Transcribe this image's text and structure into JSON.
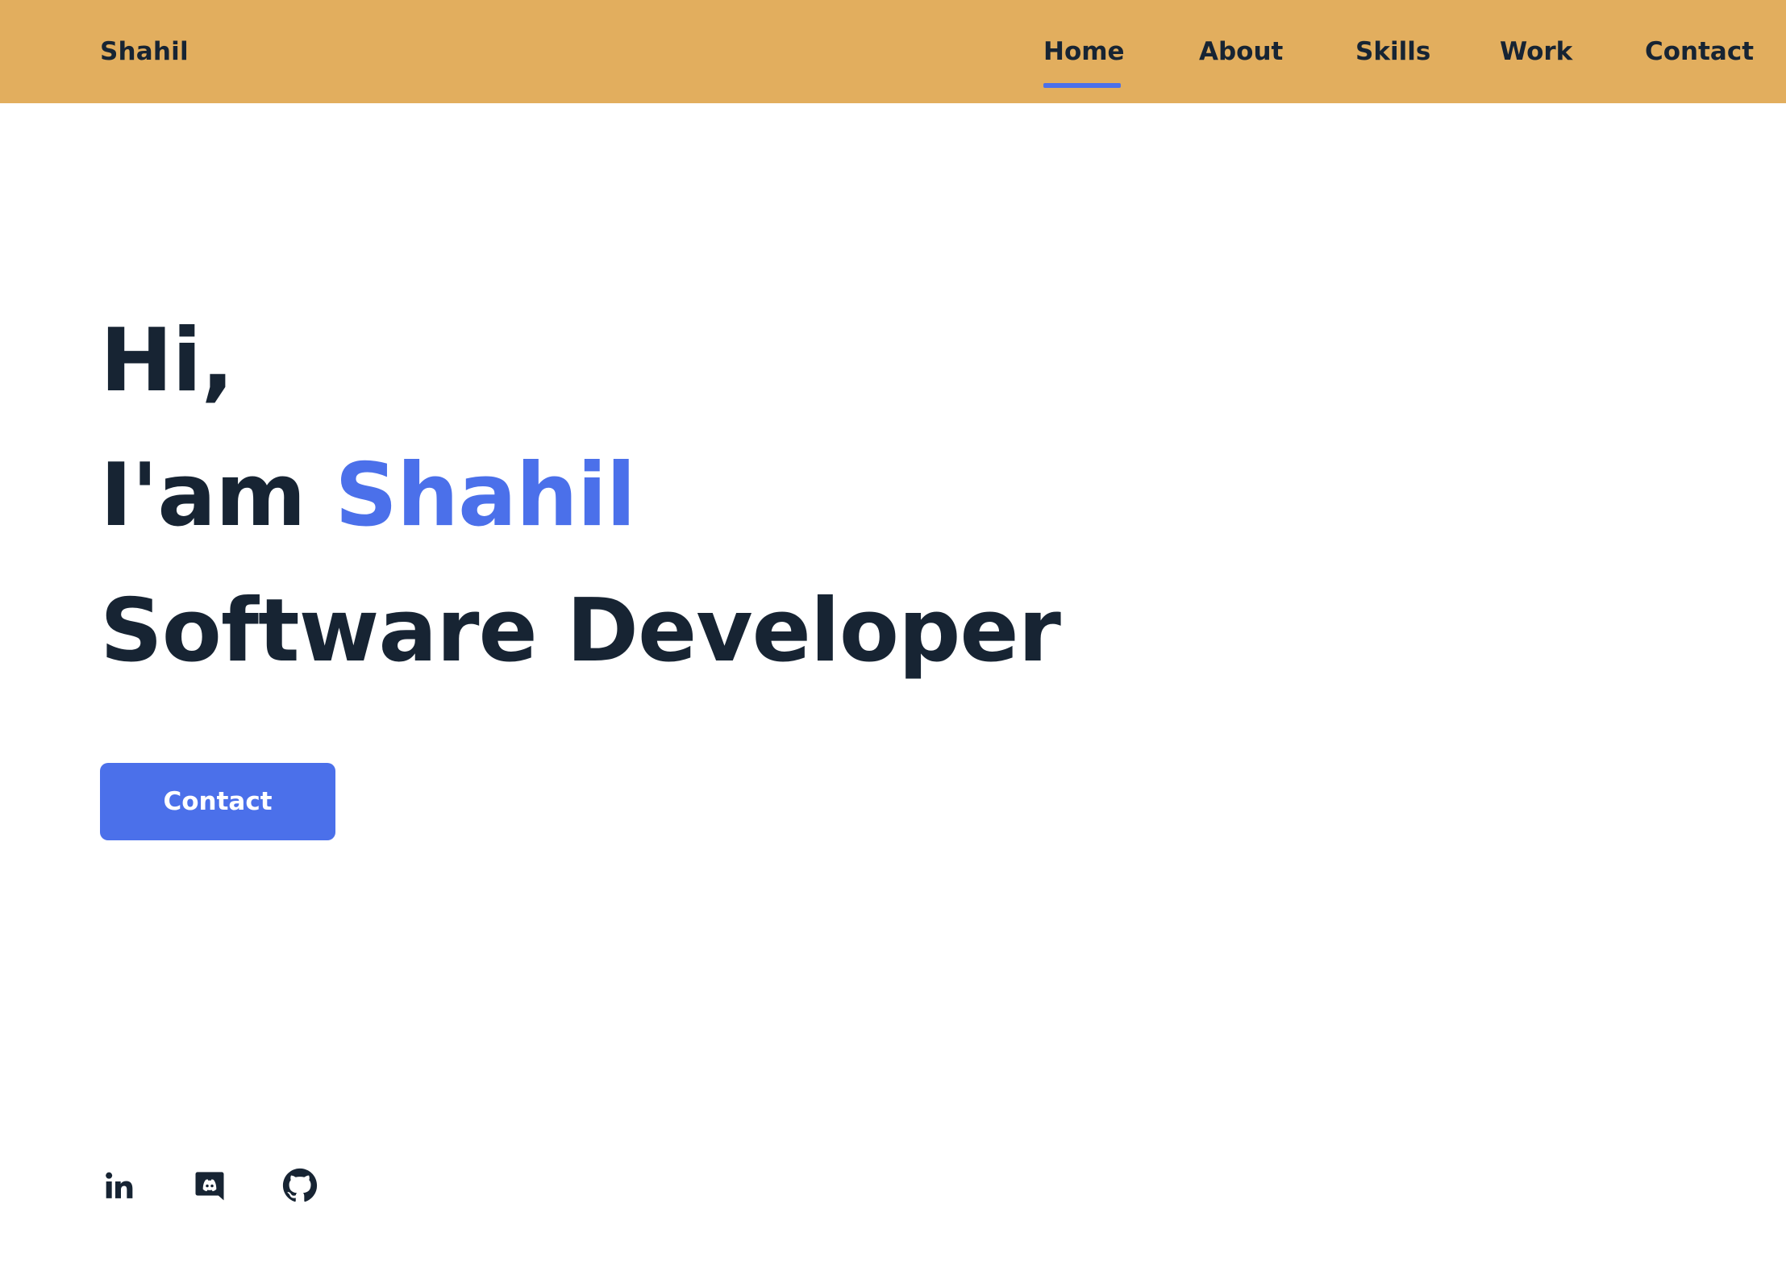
{
  "header": {
    "logo": "Shahil",
    "nav": [
      {
        "label": "Home"
      },
      {
        "label": "About"
      },
      {
        "label": "Skills"
      },
      {
        "label": "Work"
      },
      {
        "label": "Contact"
      }
    ],
    "active_nav": "Home",
    "background_color": "#e2ae5e"
  },
  "hero": {
    "greeting": "Hi,",
    "intro_prefix": "I'am",
    "name": "Shahil",
    "role": "Software Developer",
    "cta_label": "Contact"
  },
  "social": [
    {
      "icon": "linkedin-icon"
    },
    {
      "icon": "discord-icon"
    },
    {
      "icon": "github-icon"
    }
  ],
  "colors": {
    "accent": "#4b70ea",
    "text": "#172433",
    "header_bg": "#e2ae5e"
  }
}
